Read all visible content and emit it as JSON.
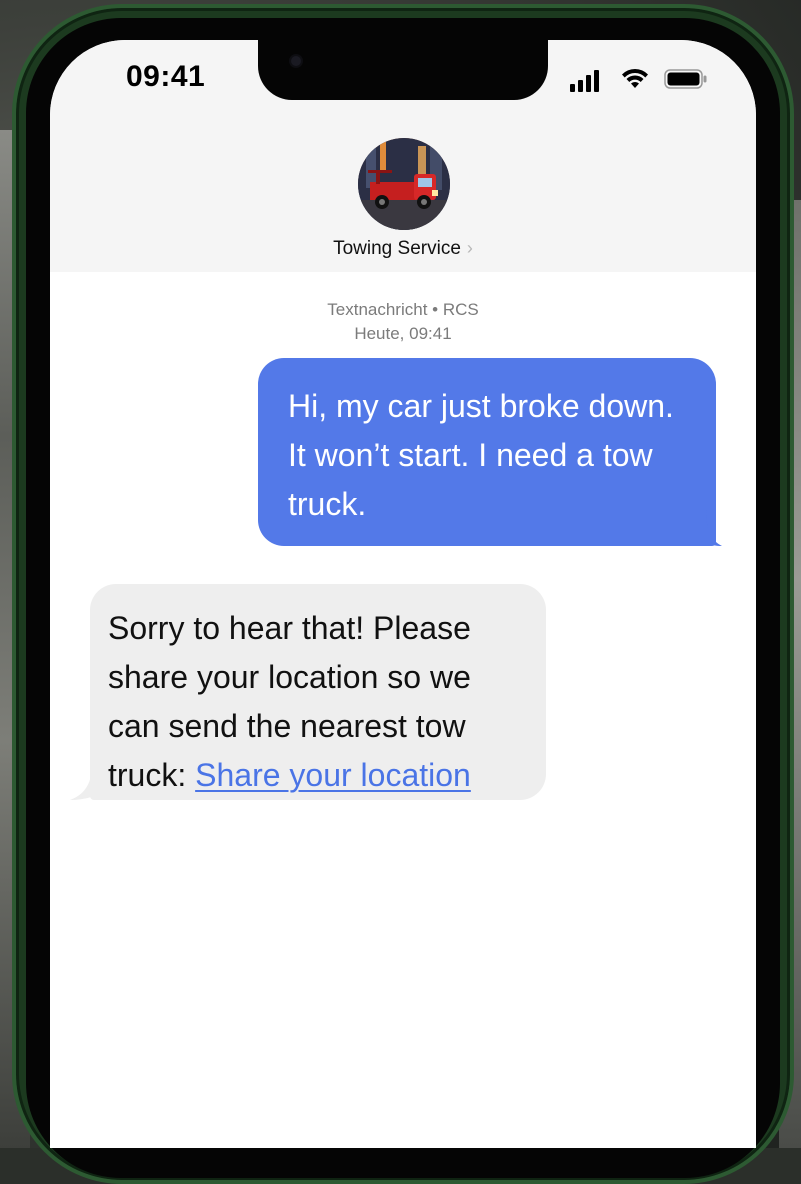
{
  "status_bar": {
    "time": "09:41",
    "icons": [
      "cellular-signal-icon",
      "wifi-icon",
      "battery-icon"
    ]
  },
  "contact": {
    "name": "Towing Service",
    "chevron": "›",
    "avatar": "tow-truck-avatar-icon"
  },
  "thread_meta": {
    "channel": "Textnachricht • RCS",
    "timestamp": "Heute, 09:41"
  },
  "messages": [
    {
      "direction": "outgoing",
      "text": "Hi, my car just broke down. It won’t start. I need a tow truck."
    },
    {
      "direction": "incoming",
      "text": "Sorry to hear that! Please share your location so we can send the nearest tow truck:",
      "link_text": "Share your location"
    }
  ],
  "colors": {
    "outgoing_bubble": "#5379e8",
    "incoming_bubble": "#eeeeee",
    "link": "#4a74e6",
    "phone_frame": "#1c3a1f"
  }
}
